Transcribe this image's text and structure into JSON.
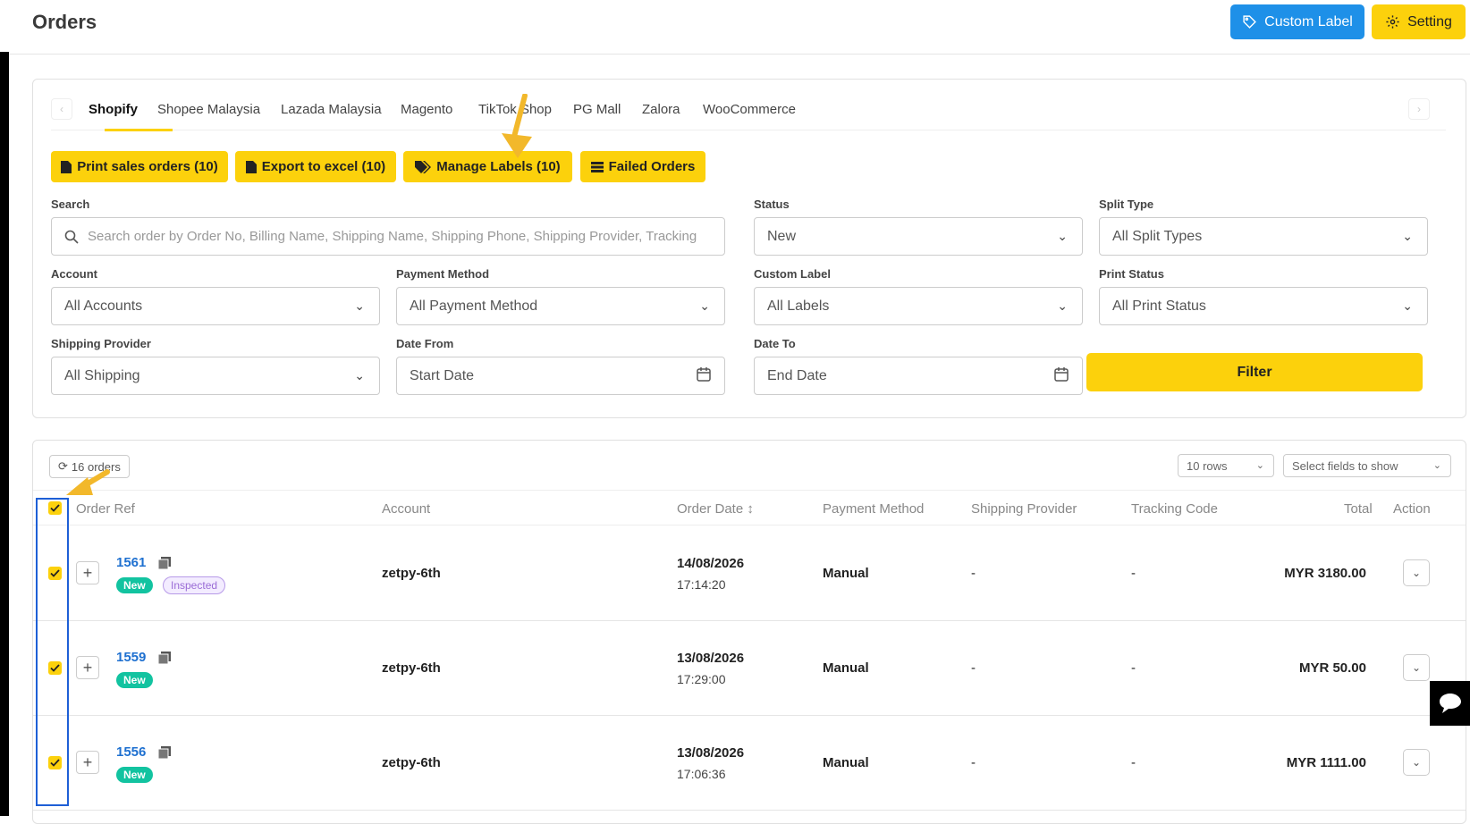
{
  "page": {
    "title": "Orders"
  },
  "header": {
    "custom_label": "Custom Label",
    "setting": "Setting"
  },
  "tabs": [
    "Shopify",
    "Shopee Malaysia",
    "Lazada Malaysia",
    "Magento",
    "TikTok Shop",
    "PG Mall",
    "Zalora",
    "WooCommerce"
  ],
  "actions": {
    "print": "Print sales orders  (10)",
    "export": "Export to excel  (10)",
    "manage": "Manage Labels  (10)",
    "failed": "Failed Orders"
  },
  "filters": {
    "search_label": "Search",
    "search_placeholder": "Search order by Order No, Billing Name, Shipping Name, Shipping Phone, Shipping Provider, Tracking",
    "status_label": "Status",
    "status_value": "New",
    "split_label": "Split Type",
    "split_value": "All Split Types",
    "account_label": "Account",
    "account_value": "All Accounts",
    "payment_label": "Payment Method",
    "payment_value": "All Payment Method",
    "custom_label_label": "Custom Label",
    "custom_label_value": "All Labels",
    "print_status_label": "Print Status",
    "print_status_value": "All Print Status",
    "shipping_label": "Shipping Provider",
    "shipping_value": "All Shipping",
    "date_from_label": "Date From",
    "date_from_placeholder": "Start Date",
    "date_to_label": "Date To",
    "date_to_placeholder": "End Date",
    "filter_button": "Filter"
  },
  "table": {
    "orders_count": "16 orders",
    "rows_select": "10 rows",
    "fields_select": "Select fields to show",
    "headers": {
      "order_ref": "Order Ref",
      "account": "Account",
      "order_date": "Order Date ↕",
      "payment": "Payment Method",
      "shipping": "Shipping Provider",
      "tracking": "Tracking Code",
      "total": "Total",
      "action": "Action"
    },
    "rows": [
      {
        "ref": "1561",
        "badge": "New",
        "badge2": "Inspected",
        "account": "zetpy-6th",
        "date": "14/08/2026",
        "time": "17:14:20",
        "payment": "Manual",
        "shipping": "-",
        "tracking": "-",
        "total": "MYR 3180.00"
      },
      {
        "ref": "1559",
        "badge": "New",
        "account": "zetpy-6th",
        "date": "13/08/2026",
        "time": "17:29:00",
        "payment": "Manual",
        "shipping": "-",
        "tracking": "-",
        "total": "MYR 50.00"
      },
      {
        "ref": "1556",
        "badge": "New",
        "account": "zetpy-6th",
        "date": "13/08/2026",
        "time": "17:06:36",
        "payment": "Manual",
        "shipping": "-",
        "tracking": "-",
        "total": "MYR 1111.00"
      }
    ]
  },
  "colors": {
    "accent": "#fcd10c",
    "blue": "#1e90e8",
    "new_badge": "#12c3a0"
  }
}
